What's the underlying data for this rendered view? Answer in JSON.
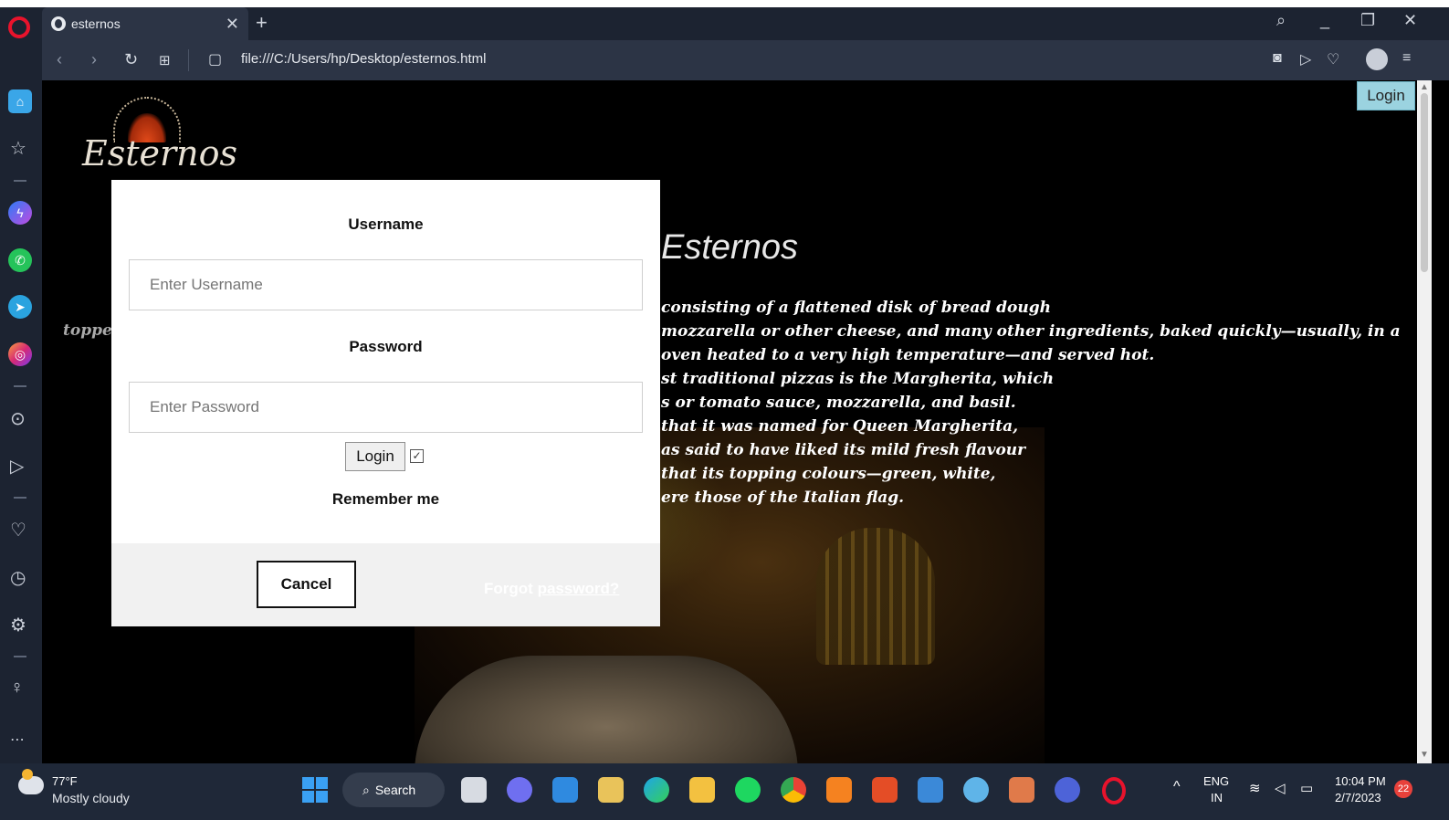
{
  "browser": {
    "tab_title": "esternos",
    "url": "file:///C:/Users/hp/Desktop/esternos.html"
  },
  "page": {
    "brand_word": "Esternos",
    "site_title": "Esternos",
    "side_word": "toppe",
    "description_lines": [
      "consisting of a flattened disk of bread dough",
      "mozzarella or other cheese, and many other ingredients, baked quickly—usually, in a",
      "oven heated to a very high temperature—and served hot.",
      "st traditional pizzas is the Margherita, which",
      "s or tomato sauce, mozzarella, and basil.",
      "that it was named for Queen Margherita,",
      "as said to have liked its mild fresh flavour",
      "that its topping colours—green, white,",
      "ere those of the Italian flag."
    ],
    "login_button": "Login"
  },
  "modal": {
    "username_label": "Username",
    "username_placeholder": "Enter Username",
    "password_label": "Password",
    "password_placeholder": "Enter Password",
    "login_button": "Login",
    "remember_checked": true,
    "remember_label": "Remember me",
    "cancel_button": "Cancel",
    "forgot_prefix": "Forgot",
    "forgot_link": "password?"
  },
  "taskbar": {
    "temperature": "77°F",
    "condition": "Mostly cloudy",
    "search_label": "Search",
    "language": "ENG",
    "region": "IN",
    "time": "10:04 PM",
    "date": "2/7/2023",
    "notification_count": "22"
  },
  "colors": {
    "accent_login": "#9bd3e0",
    "opera_red": "#e8132c",
    "chrome_dark": "#1c2331"
  }
}
